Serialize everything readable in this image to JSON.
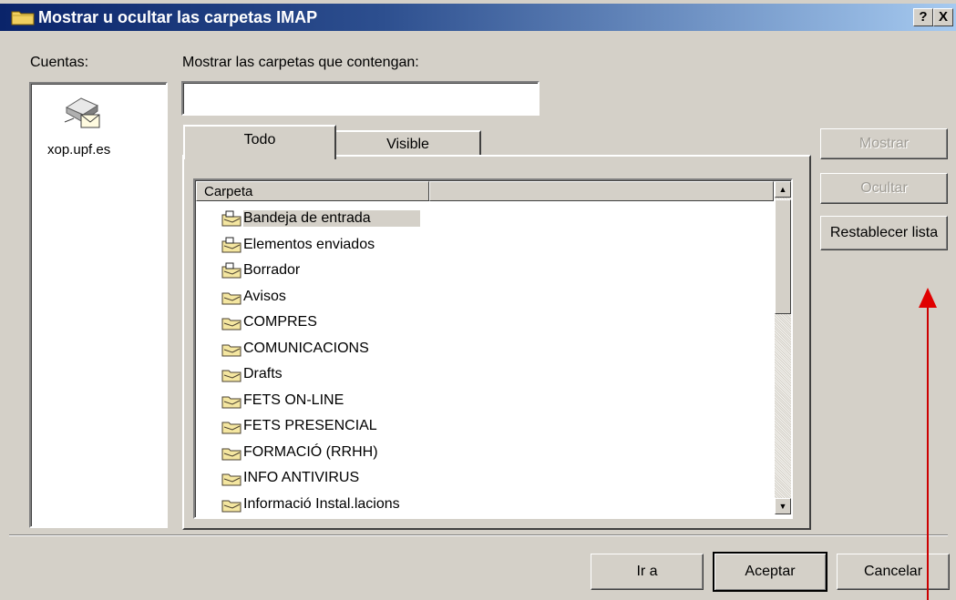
{
  "window": {
    "title": "Mostrar u ocultar las carpetas IMAP",
    "help_button": "?",
    "close_button": "X"
  },
  "accounts": {
    "label": "Cuentas:",
    "items": [
      {
        "name": "xop.upf.es",
        "icon": "mail-server-icon"
      }
    ]
  },
  "filter": {
    "label": "Mostrar las carpetas que contengan:",
    "value": ""
  },
  "tabs": [
    {
      "label": "Todo",
      "selected": true
    },
    {
      "label": "Visible",
      "selected": false
    }
  ],
  "folder_list": {
    "column_header": "Carpeta",
    "folders": [
      {
        "name": "Bandeja de entrada",
        "icon": "inbox-folder-icon",
        "selected": true
      },
      {
        "name": "Elementos enviados",
        "icon": "sent-folder-icon"
      },
      {
        "name": "Borrador",
        "icon": "drafts-folder-icon"
      },
      {
        "name": "Avisos",
        "icon": "folder-icon"
      },
      {
        "name": "COMPRES",
        "icon": "folder-icon"
      },
      {
        "name": "COMUNICACIONS",
        "icon": "folder-icon"
      },
      {
        "name": "Drafts",
        "icon": "folder-icon"
      },
      {
        "name": "FETS ON-LINE",
        "icon": "folder-icon"
      },
      {
        "name": "FETS PRESENCIAL",
        "icon": "folder-icon"
      },
      {
        "name": "FORMACIÓ (RRHH)",
        "icon": "folder-icon"
      },
      {
        "name": "INFO ANTIVIRUS",
        "icon": "folder-icon"
      },
      {
        "name": "Informació Instal.lacions",
        "icon": "folder-icon"
      }
    ]
  },
  "side_buttons": {
    "show": "Mostrar",
    "hide": "Ocultar",
    "reset": "Restablecer lista"
  },
  "bottom_buttons": {
    "goto": "Ir a",
    "ok": "Aceptar",
    "cancel": "Cancelar"
  },
  "colors": {
    "annotation_arrow": "#e00000",
    "titlebar": "#0a246a"
  }
}
